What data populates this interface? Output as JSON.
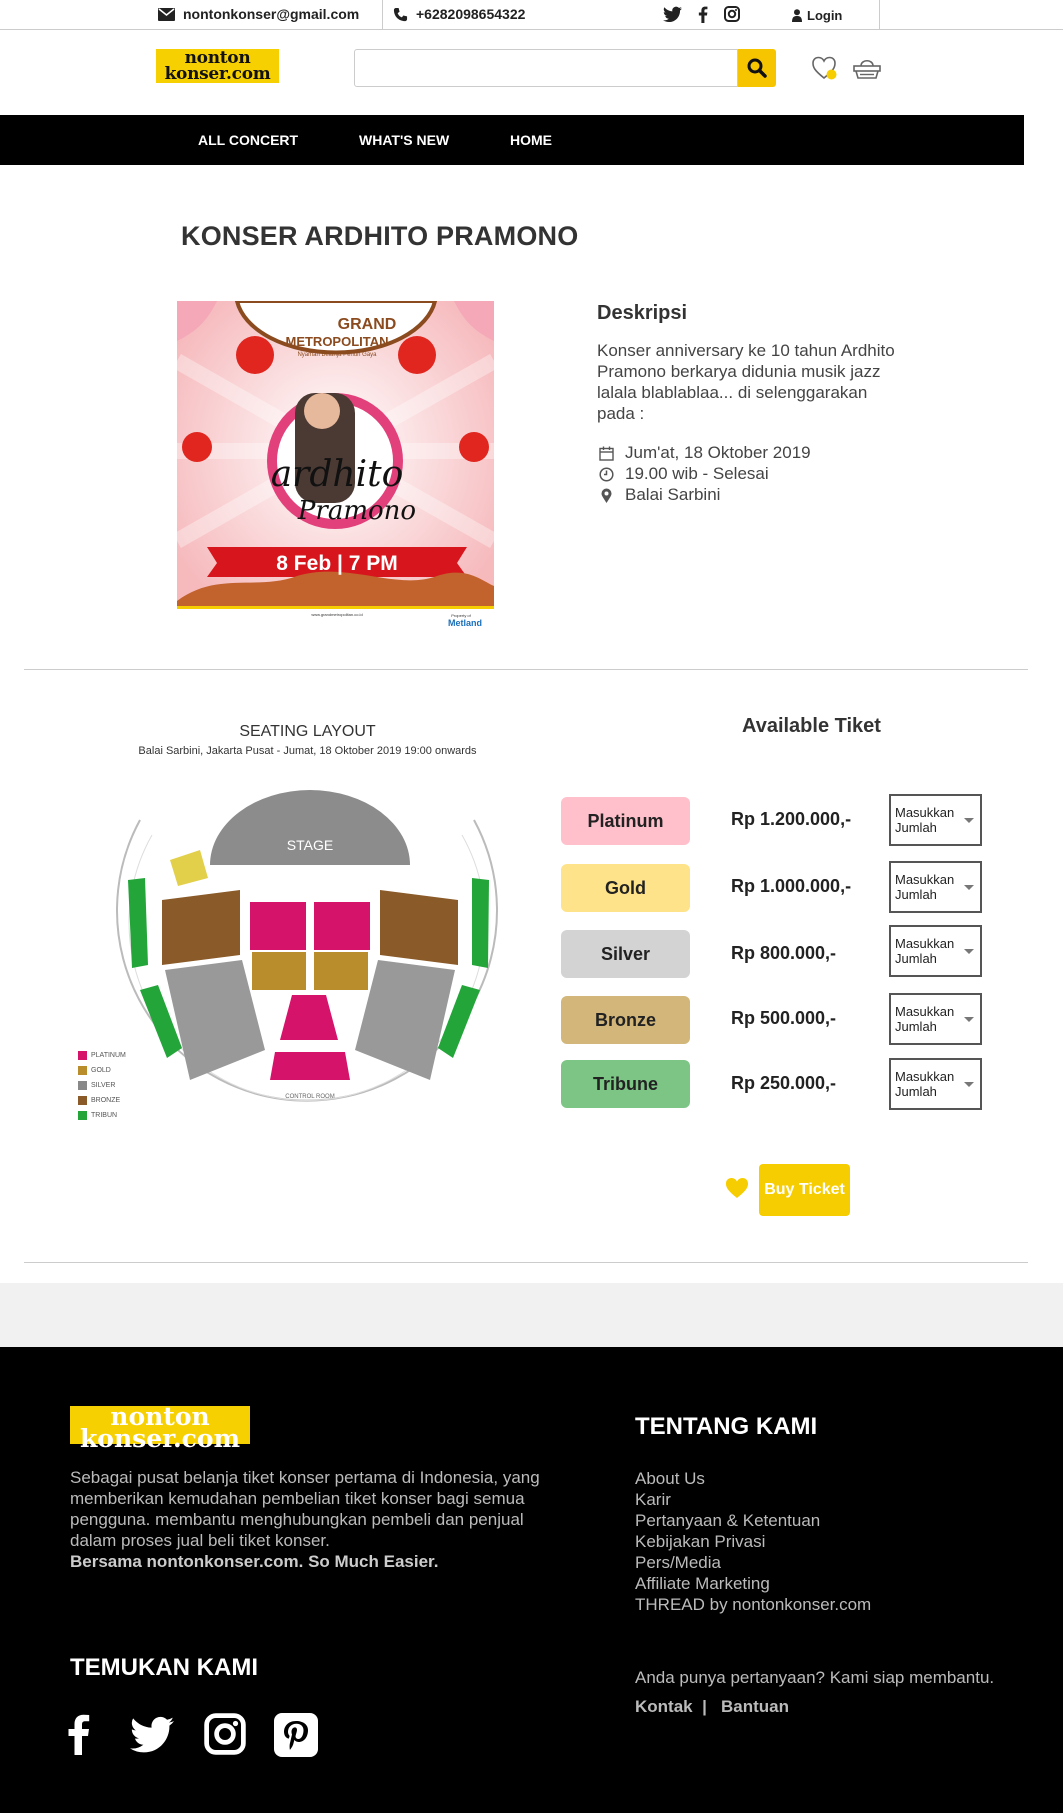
{
  "topbar": {
    "email": "nontonkonser@gmail.com",
    "phone": "+6282098654322",
    "login": "Login"
  },
  "header": {
    "logo_line1": "nonton",
    "logo_line2": "konser.com",
    "search_placeholder": ""
  },
  "nav": {
    "items": [
      "ALL CONCERT",
      "WHAT'S NEW",
      "HOME"
    ]
  },
  "event": {
    "title": "KONSER ARDHITO PRAMONO",
    "desc_heading": "Deskripsi",
    "desc_body": "Konser anniversary ke 10 tahun Ardhito Pramono berkarya didunia musik jazz lalala blablablaa... di selenggarakan pada :",
    "date": "Jum'at, 18 Oktober 2019",
    "time": "19.00 wib - Selesai",
    "venue": "Balai Sarbini"
  },
  "poster": {
    "brand1": "GRAND",
    "brand2": "METROPOLITAN",
    "tagline": "Nyaman Belanja Penuh Gaya",
    "artist1": "ardhito",
    "artist2": "Pramono",
    "banner": "8 Feb | 7 PM",
    "footer_url": "www.grandmetropolitan.co.id",
    "property_of": "Property of",
    "metland": "Metland"
  },
  "seating": {
    "title": "SEATING LAYOUT",
    "subtitle": "Balai Sarbini, Jakarta Pusat - Jumat, 18 Oktober 2019 19:00 onwards",
    "stage": "STAGE",
    "control_room": "CONTROL ROOM",
    "legend": [
      {
        "label": "PLATINUM",
        "color": "#d6136b"
      },
      {
        "label": "GOLD",
        "color": "#b98d2b"
      },
      {
        "label": "SILVER",
        "color": "#888888"
      },
      {
        "label": "BRONZE",
        "color": "#8a5a28"
      },
      {
        "label": "TRIBUN",
        "color": "#23a53a"
      }
    ]
  },
  "tickets": {
    "heading": "Available Tiket",
    "qty_placeholder": "Masukkan Jumlah",
    "items": [
      {
        "tier": "Platinum",
        "price": "Rp 1.200.000,-",
        "color": "#ffc0cb"
      },
      {
        "tier": "Gold",
        "price": "Rp 1.000.000,-",
        "color": "#ffe38a"
      },
      {
        "tier": "Silver",
        "price": "Rp 800.000,-",
        "color": "#d3d3d3"
      },
      {
        "tier": "Bronze",
        "price": "Rp 500.000,-",
        "color": "#d2b67a"
      },
      {
        "tier": "Tribune",
        "price": "Rp 250.000,-",
        "color": "#7dc585"
      }
    ],
    "buy_label": "Buy Ticket"
  },
  "footer": {
    "logo_line1": "nonton",
    "logo_line2": "konser.com",
    "about": "Sebagai pusat belanja tiket konser pertama di Indonesia, yang memberikan kemudahan pembelian tiket konser bagi semua pengguna. membantu menghubungkan pembeli dan penjual dalam proses jual beli tiket konser.",
    "about_strong": "Bersama nontonkonser.com. So Much Easier.",
    "about_heading": "TENTANG KAMI",
    "links": [
      "About Us",
      "Karir",
      "Pertanyaan & Ketentuan",
      "Kebijakan Privasi",
      "Pers/Media",
      "Affiliate Marketing",
      "THREAD by nontonkonser.com"
    ],
    "find_heading": "TEMUKAN KAMI",
    "question": "Anda punya pertanyaan? Kami siap membantu.",
    "contact": "Kontak",
    "help": "Bantuan"
  },
  "colors": {
    "brand_yellow": "#f6cd00",
    "nav_bg": "#000000"
  }
}
